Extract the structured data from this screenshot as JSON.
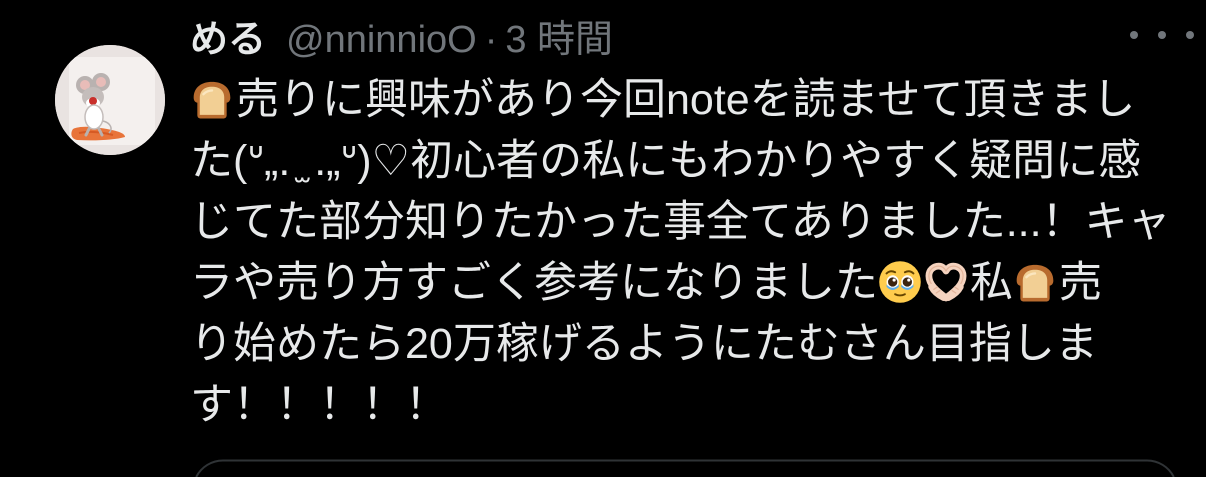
{
  "tweet": {
    "avatar_icon": "avatar-mouse-image",
    "author": {
      "display_name": "める",
      "handle": "@nninnioO",
      "separator": "·",
      "time": "3 時間"
    },
    "more_icon": "more-horizontal-icon",
    "lines": [
      [
        {
          "icon": "bread-emoji-icon"
        },
        {
          "text": "売りに興味があり今回noteを読ませて頂きまし"
        }
      ],
      [
        {
          "text": "た(ᐡ„. ̫ .„ᐡ)♡初心者の私にもわかりやすく疑問に感"
        }
      ],
      [
        {
          "text": "じてた部分知りたかった事全てありました...！キャ"
        }
      ],
      [
        {
          "text": "ラや売り方すごく参考になりました"
        },
        {
          "icon": "face-holding-back-tears-emoji-icon"
        },
        {
          "icon": "heart-hands-emoji-icon"
        },
        {
          "text": "私"
        },
        {
          "icon": "bread-emoji-icon"
        },
        {
          "text": "売"
        }
      ],
      [
        {
          "text": "り始めたら20万稼げるようにたむさん目指しま"
        }
      ],
      [
        {
          "text": "す！！！！！"
        }
      ]
    ],
    "embedded_card_icon": "quoted-card-frame"
  },
  "colors": {
    "background": "#000000",
    "text_primary": "#e7e9ea",
    "text_secondary": "#71767b",
    "border": "#2f3336"
  }
}
